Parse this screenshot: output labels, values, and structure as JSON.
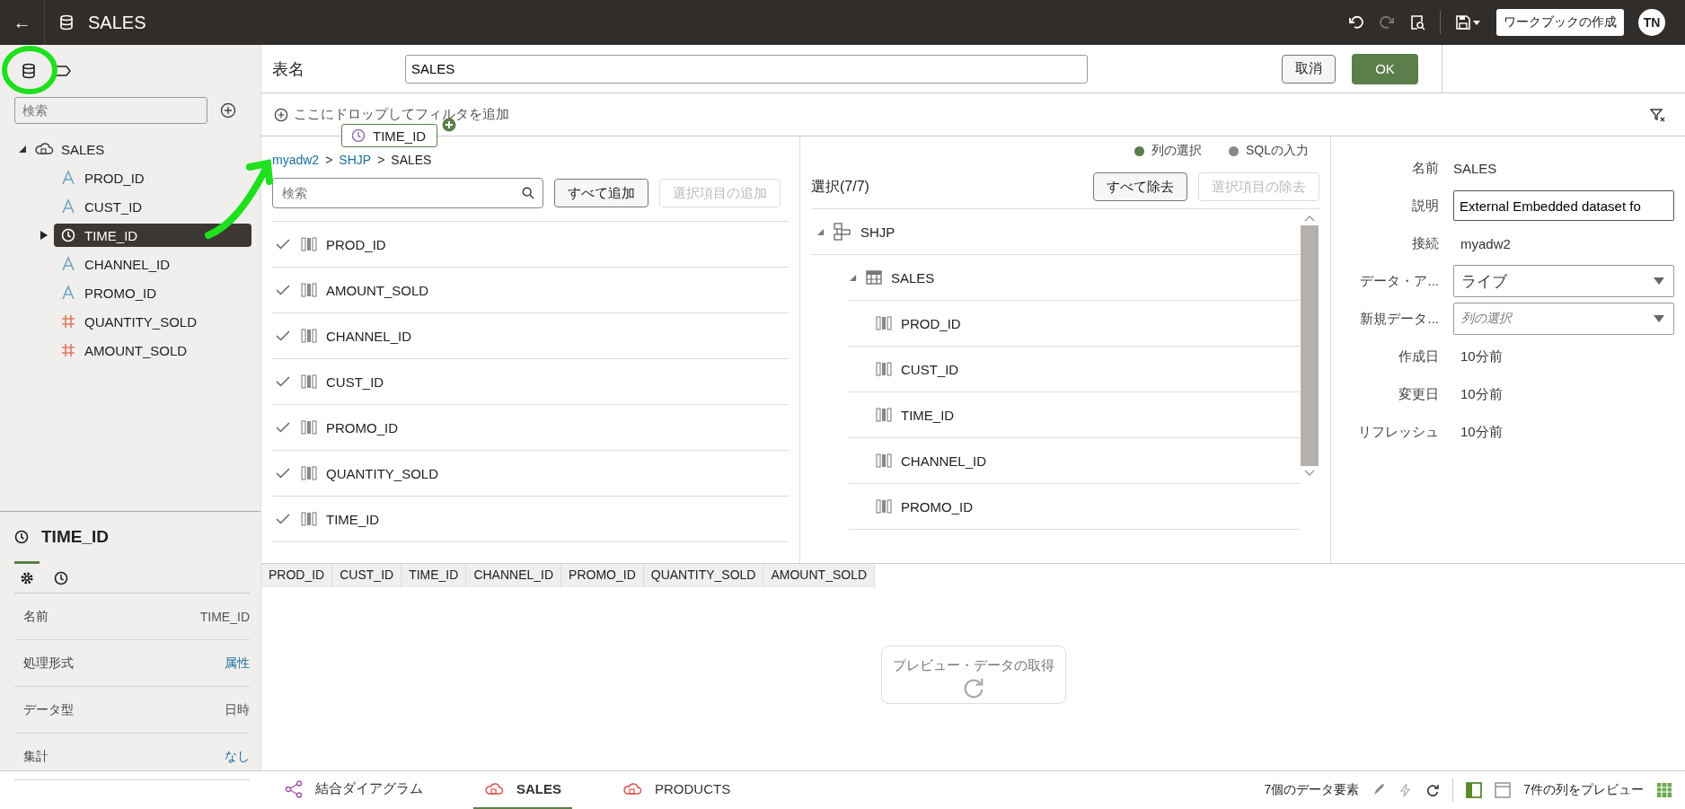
{
  "header": {
    "back": "←",
    "title": "SALES",
    "create_button": "ワークブックの作成",
    "avatar": "TN"
  },
  "sidebar": {
    "search_placeholder": "検索",
    "tree": {
      "label": "SALES",
      "expanded": true,
      "children": [
        {
          "label": "PROD_ID",
          "kind": "text",
          "selected": false,
          "expandable": false
        },
        {
          "label": "CUST_ID",
          "kind": "text",
          "selected": false,
          "expandable": false
        },
        {
          "label": "TIME_ID",
          "kind": "time",
          "selected": true,
          "expandable": true
        },
        {
          "label": "CHANNEL_ID",
          "kind": "text",
          "selected": false,
          "expandable": false
        },
        {
          "label": "PROMO_ID",
          "kind": "text",
          "selected": false,
          "expandable": false
        },
        {
          "label": "QUANTITY_SOLD",
          "kind": "number",
          "selected": false,
          "expandable": false
        },
        {
          "label": "AMOUNT_SOLD",
          "kind": "number",
          "selected": false,
          "expandable": false
        }
      ]
    },
    "detail": {
      "title": "TIME_ID",
      "tabs": [
        {
          "kind": "settings",
          "selected": true
        },
        {
          "kind": "time",
          "selected": false
        }
      ],
      "properties": [
        {
          "label": "名前",
          "value": "TIME_ID",
          "kind": "plain"
        },
        {
          "label": "処理形式",
          "value": "属性",
          "kind": "link"
        },
        {
          "label": "データ型",
          "value": "日時",
          "kind": "plain"
        },
        {
          "label": "集計",
          "value": "なし",
          "kind": "link"
        }
      ]
    }
  },
  "table_name": {
    "label": "表名",
    "value": "SALES",
    "cancel": "取消",
    "ok": "OK"
  },
  "filter_bar": {
    "placeholder": "ここにドロップしてフィルタを追加"
  },
  "drag_chip": {
    "label": "TIME_ID"
  },
  "breadcrumb": {
    "separator": ">",
    "items": [
      {
        "label": "myadw2",
        "link": true
      },
      {
        "label": "SHJP",
        "link": true
      },
      {
        "label": "SALES",
        "link": false
      }
    ]
  },
  "modes": [
    {
      "label": "列の選択",
      "selected": true
    },
    {
      "label": "SQLの入力",
      "selected": false
    }
  ],
  "available": {
    "search_placeholder": "検索",
    "add_all": "すべて追加",
    "add_selected": "選択項目の追加",
    "add_selected_disabled": true,
    "columns": [
      {
        "label": "PROD_ID",
        "checked": true
      },
      {
        "label": "AMOUNT_SOLD",
        "checked": true
      },
      {
        "label": "CHANNEL_ID",
        "checked": true
      },
      {
        "label": "CUST_ID",
        "checked": true
      },
      {
        "label": "PROMO_ID",
        "checked": true
      },
      {
        "label": "QUANTITY_SOLD",
        "checked": true
      },
      {
        "label": "TIME_ID",
        "checked": true
      }
    ]
  },
  "selection": {
    "title": "選択(7/7)",
    "remove_all": "すべて除去",
    "remove_selected": "選択項目の除去",
    "remove_selected_disabled": true,
    "schema": "SHJP",
    "table": "SALES",
    "columns": [
      "PROD_ID",
      "CUST_ID",
      "TIME_ID",
      "CHANNEL_ID",
      "PROMO_ID"
    ]
  },
  "properties": [
    {
      "label": "名前",
      "value": "SALES",
      "kind": "text"
    },
    {
      "label": "説明",
      "value": "External Embedded dataset fo",
      "kind": "input"
    },
    {
      "label": "接続",
      "value": "myadw2",
      "kind": "text"
    },
    {
      "label": "データ・ア...",
      "value": "ライブ",
      "kind": "select"
    },
    {
      "label": "新規データ...",
      "placeholder": "列の選択",
      "kind": "select"
    },
    {
      "label": "作成日",
      "value": "10分前",
      "kind": "text"
    },
    {
      "label": "変更日",
      "value": "10分前",
      "kind": "text"
    },
    {
      "label": "リフレッシュ",
      "value": "10分前",
      "kind": "text"
    }
  ],
  "preview": {
    "columns": [
      "PROD_ID",
      "CUST_ID",
      "TIME_ID",
      "CHANNEL_ID",
      "PROMO_ID",
      "QUANTITY_SOLD",
      "AMOUNT_SOLD"
    ],
    "loader": "プレビュー・データの取得"
  },
  "bottom_tabs": [
    {
      "label": "結合ダイアグラム",
      "kind": "diagram",
      "selected": false
    },
    {
      "label": "SALES",
      "kind": "cloud",
      "selected": true
    },
    {
      "label": "PRODUCTS",
      "kind": "cloud",
      "selected": false
    }
  ],
  "status": {
    "elements": "7個のデータ要素",
    "preview": "7件の列をプレビュー"
  }
}
